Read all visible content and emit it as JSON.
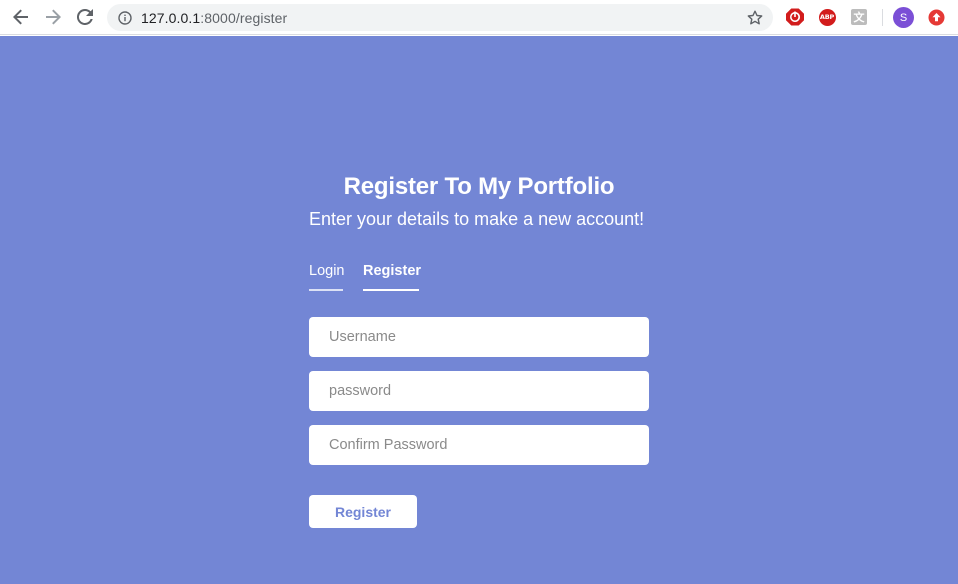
{
  "browser": {
    "url_host": "127.0.0.1",
    "url_path": ":8000/register",
    "icons": [
      "back-arrow-icon",
      "forward-arrow-icon",
      "reload-icon",
      "info-icon",
      "star-icon"
    ],
    "extensions": {
      "abp_label": "ABP",
      "translate_label": "文",
      "avatar_letter": "S"
    },
    "colors": {
      "omnibox_bg": "#f1f3f4",
      "avatar": "#7b4fd6",
      "abp": "#d21c1c"
    }
  },
  "page": {
    "background": "#7386d5",
    "title": "Register To My Portfolio",
    "subtitle": "Enter your details to make a new account!",
    "tabs": [
      {
        "label": "Login",
        "active": false
      },
      {
        "label": "Register",
        "active": true
      }
    ],
    "form": {
      "username_placeholder": "Username",
      "password_placeholder": "password",
      "confirm_placeholder": "Confirm Password",
      "submit_label": "Register"
    }
  }
}
